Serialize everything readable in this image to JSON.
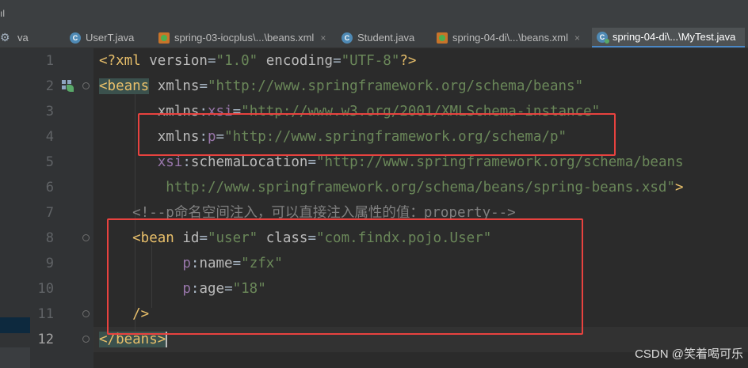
{
  "top_glyph": "ıl",
  "tabs": [
    {
      "label": "va",
      "icon": "",
      "close": ""
    },
    {
      "label": "UserT.java",
      "icon": "java-class-icon",
      "close": ""
    },
    {
      "label": "spring-03-iocplus\\...\\beans.xml",
      "icon": "xml-file-icon",
      "close": "×"
    },
    {
      "label": "Student.java",
      "icon": "java-class-icon",
      "close": ""
    },
    {
      "label": "spring-04-di\\...\\beans.xml",
      "icon": "xml-file-icon",
      "close": "×"
    },
    {
      "label": "spring-04-di\\...\\MyTest.java",
      "icon": "java-test-class-icon",
      "close": ""
    }
  ],
  "line_numbers": [
    "1",
    "2",
    "3",
    "4",
    "5",
    "6",
    "7",
    "8",
    "9",
    "10",
    "11",
    "12"
  ],
  "code_lines": [
    [
      [
        "pi",
        "<?xml "
      ],
      [
        "attr",
        "version"
      ],
      [
        "plain",
        "="
      ],
      [
        "str",
        "\"1.0\""
      ],
      [
        "plain",
        " "
      ],
      [
        "attr",
        "encoding"
      ],
      [
        "plain",
        "="
      ],
      [
        "str",
        "\"UTF-8\""
      ],
      [
        "pi",
        "?>"
      ]
    ],
    [
      [
        "tagbg",
        "<beans"
      ],
      [
        "plain",
        " "
      ],
      [
        "attr",
        "xmlns"
      ],
      [
        "plain",
        "="
      ],
      [
        "str",
        "\"http://www.springframework.org/schema/beans\""
      ]
    ],
    [
      [
        "plain",
        "       "
      ],
      [
        "attr",
        "xmlns"
      ],
      [
        "plain",
        ":"
      ],
      [
        "ns",
        "xsi"
      ],
      [
        "plain",
        "="
      ],
      [
        "str",
        "\"http://www.w3.org/2001/XMLSchema-instance\""
      ]
    ],
    [
      [
        "plain",
        "       "
      ],
      [
        "attr",
        "xmlns"
      ],
      [
        "plain",
        ":"
      ],
      [
        "ns",
        "p"
      ],
      [
        "plain",
        "="
      ],
      [
        "str",
        "\"http://www.springframework.org/schema/p\""
      ]
    ],
    [
      [
        "plain",
        "       "
      ],
      [
        "ns",
        "xsi"
      ],
      [
        "plain",
        ":"
      ],
      [
        "attr",
        "schemaLocation"
      ],
      [
        "plain",
        "="
      ],
      [
        "str",
        "\"http://www.springframework.org/schema/beans"
      ]
    ],
    [
      [
        "str",
        "        http://www.springframework.org/schema/beans/spring-beans.xsd\""
      ],
      [
        "tag",
        ">"
      ]
    ],
    [
      [
        "com",
        "    <!--p命名空间注入，可以直接注入属性的值：property-->"
      ]
    ],
    [
      [
        "tag",
        "    <bean "
      ],
      [
        "attr",
        "id"
      ],
      [
        "plain",
        "="
      ],
      [
        "str",
        "\"user\""
      ],
      [
        "plain",
        " "
      ],
      [
        "attr",
        "class"
      ],
      [
        "plain",
        "="
      ],
      [
        "str",
        "\"com.findx.pojo.User\""
      ]
    ],
    [
      [
        "plain",
        "          "
      ],
      [
        "ns",
        "p"
      ],
      [
        "plain",
        ":"
      ],
      [
        "attr",
        "name"
      ],
      [
        "plain",
        "="
      ],
      [
        "str",
        "\"zfx\""
      ]
    ],
    [
      [
        "plain",
        "          "
      ],
      [
        "ns",
        "p"
      ],
      [
        "plain",
        ":"
      ],
      [
        "attr",
        "age"
      ],
      [
        "plain",
        "="
      ],
      [
        "str",
        "\"18\""
      ]
    ],
    [
      [
        "tag",
        "    />"
      ]
    ],
    [
      [
        "tagbg",
        "</beans>"
      ],
      [
        "caret",
        ""
      ]
    ]
  ],
  "highlight_color": "#e8423f",
  "watermark": "CSDN @笑着喝可乐"
}
